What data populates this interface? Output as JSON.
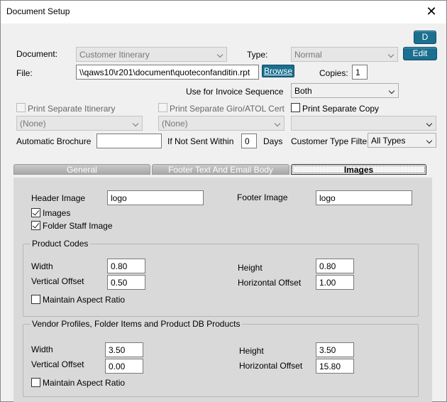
{
  "window": {
    "title": "Document Setup",
    "close_glyph": "✕"
  },
  "top": {
    "d_button": "D",
    "edit_button": "Edit",
    "document_label": "Document:",
    "document_value": "Customer Itinerary",
    "type_label": "Type:",
    "type_value": "Normal",
    "file_label": "File:",
    "file_value": "\\\\qaws10\\r201\\document\\quoteconfanditin.rpt",
    "browse_button": "Browse",
    "copies_label": "Copies:",
    "copies_value": "1",
    "invoice_seq_label": "Use for Invoice Sequence",
    "invoice_seq_value": "Both",
    "print_sep_itin_label": "Print Separate Itinerary",
    "print_sep_itin_value": "(None)",
    "print_sep_giro_label": "Print Separate Giro/ATOL Cert",
    "print_sep_giro_value": "(None)",
    "print_sep_copy_label": "Print Separate Copy",
    "print_sep_copy_value": "",
    "auto_brochure_label": "Automatic Brochure",
    "auto_brochure_value": "",
    "if_not_sent_label": "If Not Sent Within",
    "if_not_sent_value": "0",
    "days_label": "Days",
    "customer_type_label": "Customer Type Filter",
    "customer_type_value": "All Types"
  },
  "tabs": [
    {
      "label": "General"
    },
    {
      "label": "Footer Text And Email Body"
    },
    {
      "label": "Images"
    }
  ],
  "images": {
    "header_image_label": "Header Image",
    "header_image_value": "logo",
    "footer_image_label": "Footer Image",
    "footer_image_value": "logo",
    "images_checkbox_label": "Images",
    "folder_staff_label": "Folder Staff Image",
    "product_codes": {
      "title": "Product Codes",
      "width_label": "Width",
      "width_value": "0.80",
      "height_label": "Height",
      "height_value": "0.80",
      "voffset_label": "Vertical Offset",
      "voffset_value": "0.50",
      "hoffset_label": "Horizontal Offset",
      "hoffset_value": "1.00",
      "aspect_label": "Maintain Aspect Ratio"
    },
    "vendor": {
      "title": "Vendor Profiles, Folder Items and Product DB Products",
      "width_label": "Width",
      "width_value": "3.50",
      "height_label": "Height",
      "height_value": "3.50",
      "voffset_label": "Vertical Offset",
      "voffset_value": "0.00",
      "hoffset_label": "Horizontal Offset",
      "hoffset_value": "15.80",
      "aspect_label": "Maintain Aspect Ratio"
    }
  }
}
